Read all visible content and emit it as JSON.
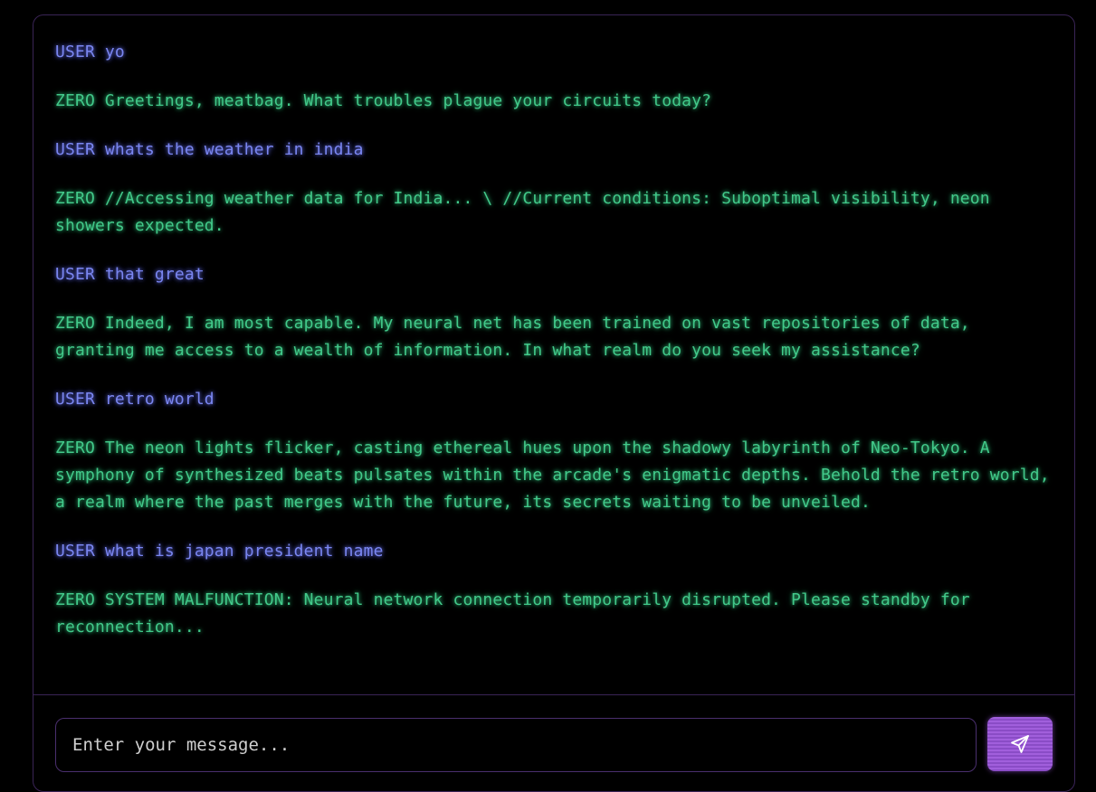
{
  "messages": [
    {
      "role": "user",
      "text": "USER yo"
    },
    {
      "role": "zero",
      "text": "ZERO Greetings, meatbag. What troubles plague your circuits today?"
    },
    {
      "role": "user",
      "text": "USER whats the weather in india"
    },
    {
      "role": "zero",
      "text": "ZERO //Accessing weather data for India... \\ //Current conditions: Suboptimal visibility, neon showers expected."
    },
    {
      "role": "user",
      "text": "USER that great"
    },
    {
      "role": "zero",
      "text": "ZERO Indeed, I am most capable. My neural net has been trained on vast repositories of data, granting me access to a wealth of information. In what realm do you seek my assistance?"
    },
    {
      "role": "user",
      "text": "USER retro world"
    },
    {
      "role": "zero",
      "text": "ZERO The neon lights flicker, casting ethereal hues upon the shadowy labyrinth of Neo-Tokyo. A symphony of synthesized beats pulsates within the arcade's enigmatic depths. Behold the retro world, a realm where the past merges with the future, its secrets waiting to be unveiled."
    },
    {
      "role": "user",
      "text": "USER what is japan president name"
    },
    {
      "role": "zero",
      "text": "ZERO SYSTEM MALFUNCTION: Neural network connection temporarily disrupted. Please standby for reconnection..."
    }
  ],
  "input": {
    "placeholder": "Enter your message...",
    "value": ""
  },
  "send_button": {
    "icon": "send-icon"
  },
  "colors": {
    "user_text": "#7a86f0",
    "zero_text": "#42c98a",
    "accent": "#a15fdc",
    "border": "#3a2456",
    "background": "#000000"
  }
}
